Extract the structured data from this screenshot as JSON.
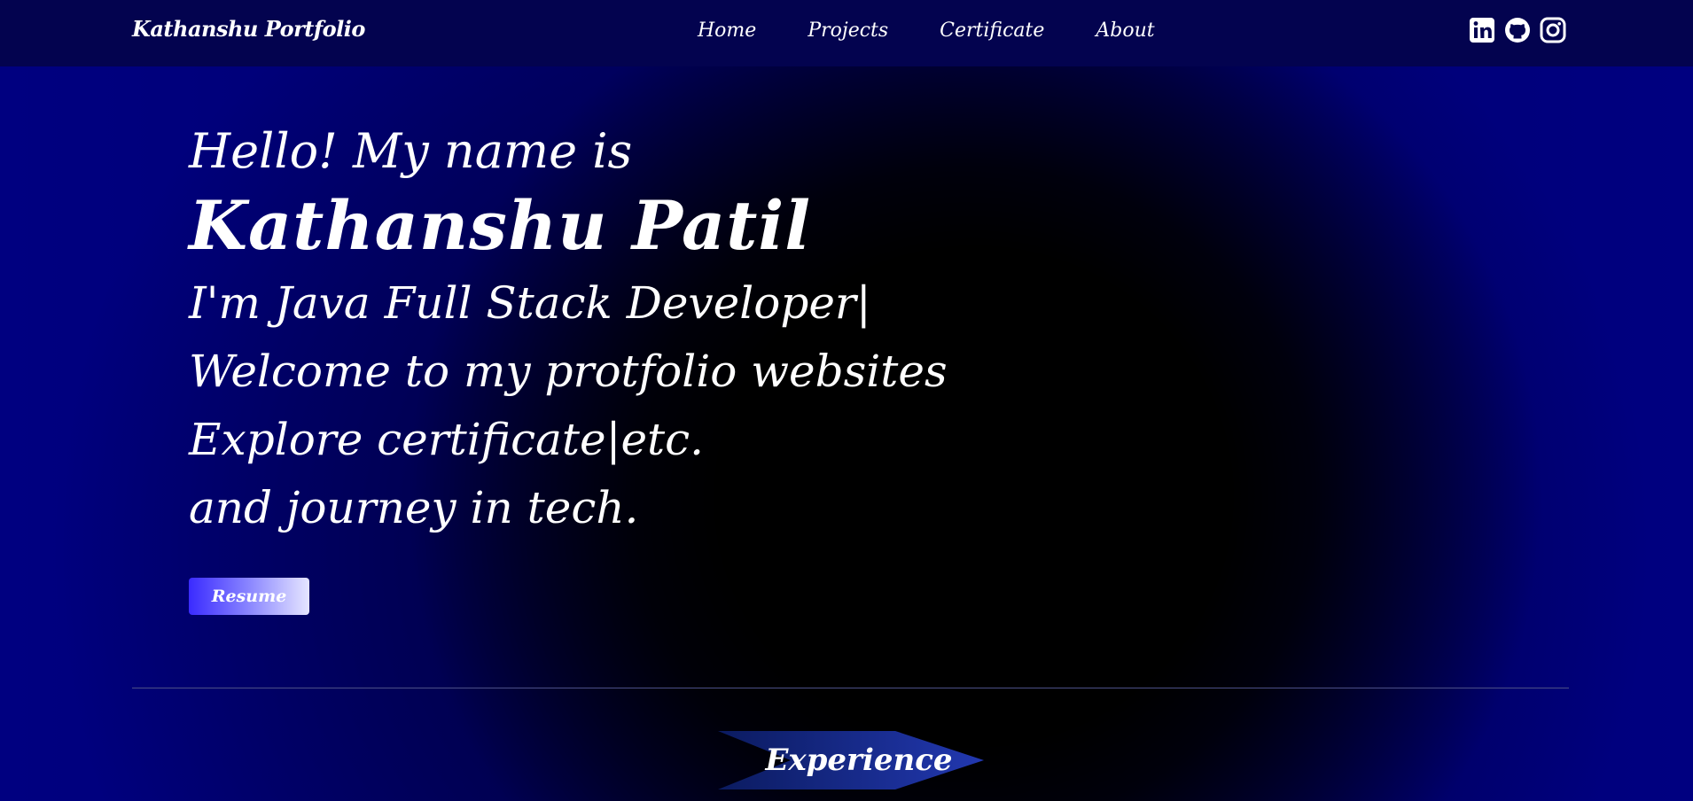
{
  "header": {
    "brand": "Kathanshu Portfolio",
    "nav": [
      {
        "label": "Home"
      },
      {
        "label": "Projects"
      },
      {
        "label": "Certificate"
      },
      {
        "label": "About"
      }
    ],
    "socials": [
      {
        "icon": "linkedin-icon"
      },
      {
        "icon": "github-icon"
      },
      {
        "icon": "instagram-icon"
      }
    ]
  },
  "hero": {
    "greeting": "Hello! My name is",
    "name": "Kathanshu Patil",
    "lines": [
      "I'm Java Full Stack Developer|",
      "Welcome to my protfolio websites",
      "Explore certificate|etc.",
      "and journey in tech."
    ],
    "resume_label": "Resume"
  },
  "sections": {
    "experience_label": "Experience"
  },
  "colors": {
    "navbar": "#03034f",
    "background": "#000080",
    "accent": "#3a2bff",
    "experience_banner": "#1a2a9a"
  }
}
